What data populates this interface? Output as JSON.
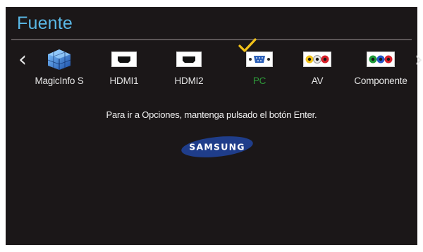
{
  "screen": {
    "title": "Fuente",
    "hint": "Para ir a Opciones, mantenga pulsado el botón Enter.",
    "brand": "SAMSUNG"
  },
  "nav": {
    "left_arrow": "‹",
    "right_arrow": "›"
  },
  "sources": [
    {
      "label": "MagicInfo S",
      "icon": "magicinfo-cube-icon",
      "selected": false
    },
    {
      "label": "HDMI1",
      "icon": "hdmi-port-icon",
      "selected": false
    },
    {
      "label": "HDMI2",
      "icon": "hdmi-port-icon",
      "selected": false
    },
    {
      "label": "PC",
      "icon": "vga-port-icon",
      "selected": true
    },
    {
      "label": "AV",
      "icon": "av-rca-ports-icon",
      "selected": false
    },
    {
      "label": "Componente",
      "icon": "component-rca-ports-icon",
      "selected": false
    }
  ],
  "colors": {
    "background": "#1b1718",
    "title": "#5ab8e6",
    "selected_label": "#2e9a3a",
    "checkmark": "#f2c21a",
    "brand_blue": "#1f3d8a"
  }
}
